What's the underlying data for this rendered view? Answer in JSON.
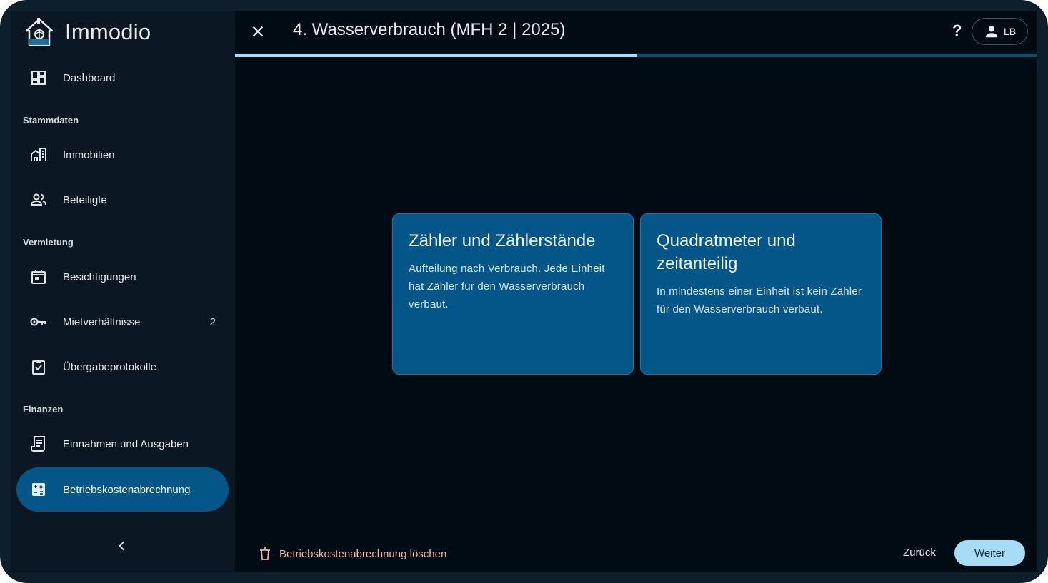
{
  "app": {
    "name": "Immodio"
  },
  "sidebar": {
    "dashboard": {
      "label": "Dashboard",
      "icon": "dashboard-icon"
    },
    "sections": {
      "stammdaten": "Stammdaten",
      "vermietung": "Vermietung",
      "finanzen": "Finanzen"
    },
    "items": [
      {
        "label": "Immobilien",
        "icon": "buildings-icon"
      },
      {
        "label": "Beteiligte",
        "icon": "people-icon"
      },
      {
        "label": "Besichtigungen",
        "icon": "calendar-icon"
      },
      {
        "label": "Mietverhältnisse",
        "icon": "key-icon",
        "badge": "2"
      },
      {
        "label": "Übergabeprotokolle",
        "icon": "clipboard-check-icon"
      },
      {
        "label": "Einnahmen und Ausgaben",
        "icon": "receipt-icon"
      },
      {
        "label": "Betriebskostenabrechnung",
        "icon": "calculator-icon",
        "active": true
      }
    ]
  },
  "header": {
    "title": "4. Wasserverbrauch (MFH 2 | 2025)",
    "help": "?",
    "user_initials": "LB",
    "progress": 0.5
  },
  "cards": [
    {
      "title": "Zähler und Zählerstände",
      "text": "Aufteilung nach Verbrauch. Jede Einheit hat Zähler für den Wasserverbrauch verbaut."
    },
    {
      "title": "Quadratmeter und zeitanteilig",
      "text": "In mindestens einer Einheit ist kein Zähler für den Wasserverbrauch verbaut."
    }
  ],
  "footer": {
    "delete_label": "Betriebskostenabrechnung löschen",
    "back_label": "Zurück",
    "next_label": "Weiter"
  },
  "colors": {
    "background": "#010b13",
    "sidebar": "#0b1823",
    "accent": "#035687",
    "primary_button": "#a6dcf5",
    "danger_text": "#f3b6a3"
  }
}
